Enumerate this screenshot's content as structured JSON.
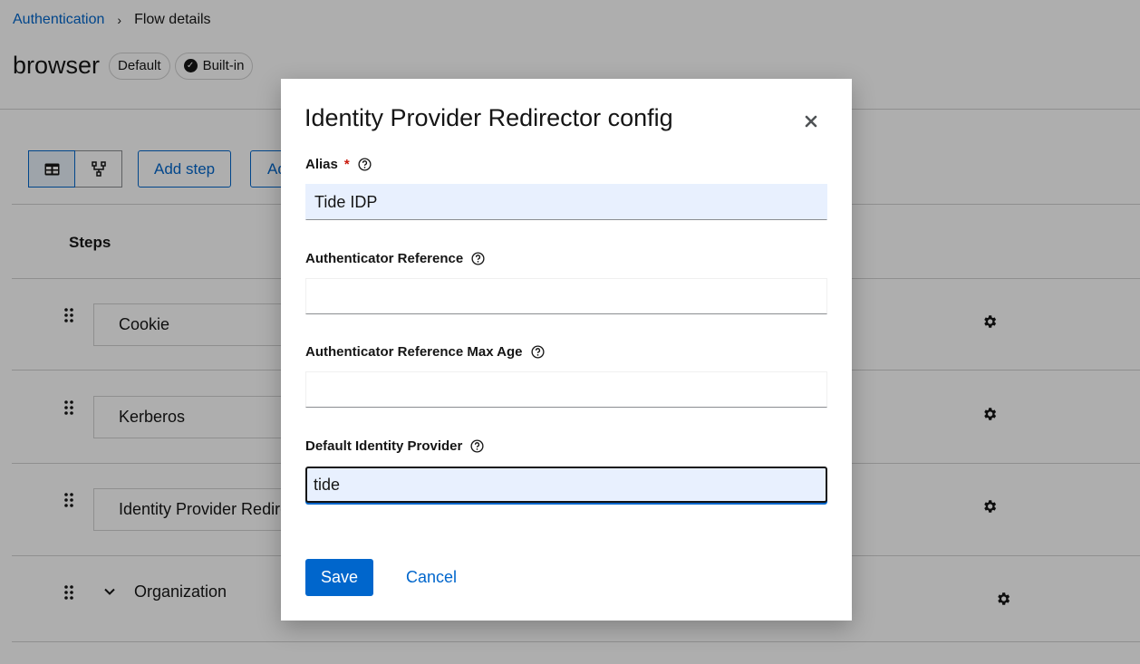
{
  "breadcrumb": {
    "parent": "Authentication",
    "separator": "›",
    "current": "Flow details"
  },
  "flow": {
    "name": "browser",
    "labels": [
      "Default",
      "Built-in"
    ]
  },
  "toolbar": {
    "add_step_label": "Add step",
    "add_condition_label": "Add condition"
  },
  "table": {
    "header": "Steps",
    "rows": [
      "Cookie",
      "Kerberos",
      "Identity Provider Redirector",
      "Organization"
    ]
  },
  "icons": {
    "table_view": "table-icon",
    "diagram_view": "diagram-icon",
    "drag": "drag-handle-icon",
    "settings": "gear-icon",
    "help": "question-circle-icon",
    "close": "close-icon",
    "check": "check-circle-icon",
    "expand": "chevron-down-icon"
  },
  "modal": {
    "title": "Identity Provider Redirector config",
    "fields": {
      "alias": {
        "label": "Alias",
        "required_mark": "*",
        "value": "Tide IDP"
      },
      "auth_ref": {
        "label": "Authenticator Reference",
        "value": ""
      },
      "auth_ref_max_age": {
        "label": "Authenticator Reference Max Age",
        "value": ""
      },
      "default_idp": {
        "label": "Default Identity Provider",
        "value": "tide"
      }
    },
    "save_label": "Save",
    "cancel_label": "Cancel"
  },
  "colors": {
    "primary": "#0066cc",
    "danger": "#c9190b",
    "autofill": "#e8f0fe"
  }
}
